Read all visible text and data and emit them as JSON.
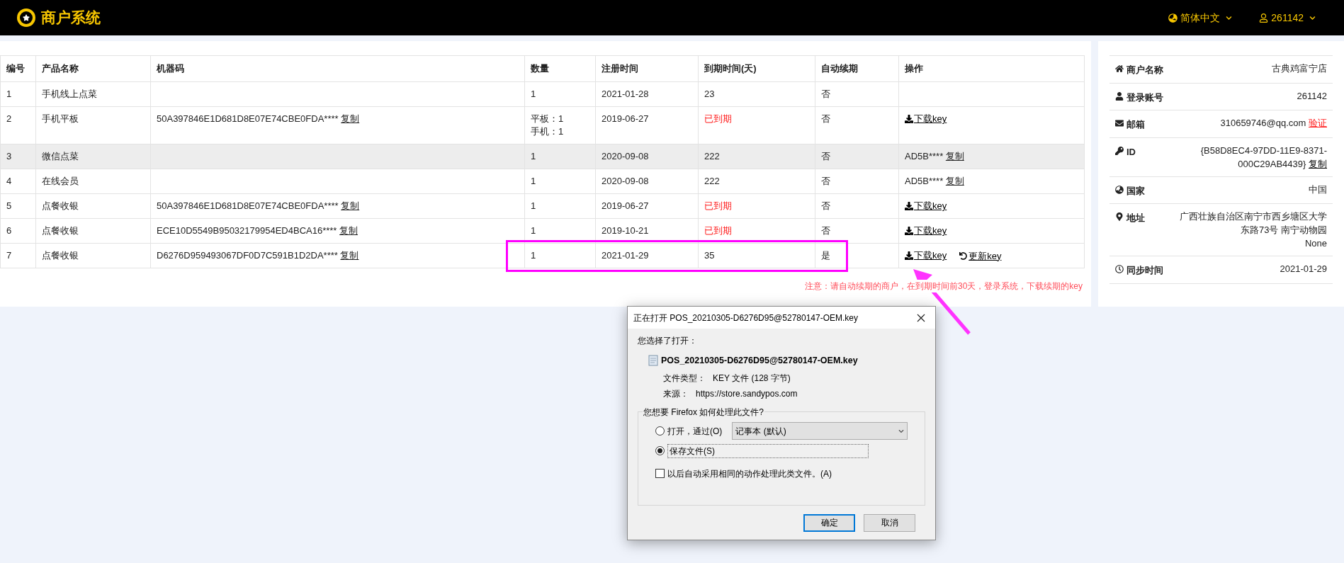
{
  "header": {
    "brand": "商户系统",
    "language": "简体中文",
    "user": "261142"
  },
  "table": {
    "columns": [
      "编号",
      "产品名称",
      "机器码",
      "数量",
      "注册时间",
      "到期时间(天)",
      "自动续期",
      "操作"
    ],
    "rows": [
      {
        "no": "1",
        "product": "手机线上点菜",
        "quantity": [
          "1"
        ],
        "registered": "2021-01-28",
        "expiry": {
          "text": "23",
          "expired": false
        },
        "auto_renew": "否",
        "highlighted": false
      },
      {
        "no": "2",
        "product": "手机平板",
        "machine_code": {
          "code": "50A397846E1D681D8E07E74CBE0FDA****",
          "copy": "复制"
        },
        "quantity": [
          "平板：1",
          "手机：1"
        ],
        "registered": "2019-06-27",
        "expiry": {
          "text": "已到期",
          "expired": true
        },
        "auto_renew": "否",
        "actions": [
          {
            "kind": "download",
            "label": "下载key"
          }
        ],
        "highlighted": false
      },
      {
        "no": "3",
        "product": "微信点菜",
        "quantity": [
          "1"
        ],
        "registered": "2020-09-08",
        "expiry": {
          "text": "222",
          "expired": false
        },
        "auto_renew": "否",
        "actions": [
          {
            "kind": "code",
            "code": "AD5B****",
            "label": "复制"
          }
        ],
        "highlighted": true
      },
      {
        "no": "4",
        "product": "在线会员",
        "quantity": [
          "1"
        ],
        "registered": "2020-09-08",
        "expiry": {
          "text": "222",
          "expired": false
        },
        "auto_renew": "否",
        "actions": [
          {
            "kind": "code",
            "code": "AD5B****",
            "label": "复制"
          }
        ],
        "highlighted": false
      },
      {
        "no": "5",
        "product": "点餐收银",
        "machine_code": {
          "code": "50A397846E1D681D8E07E74CBE0FDA****",
          "copy": "复制"
        },
        "quantity": [
          "1"
        ],
        "registered": "2019-06-27",
        "expiry": {
          "text": "已到期",
          "expired": true
        },
        "auto_renew": "否",
        "actions": [
          {
            "kind": "download",
            "label": "下载key"
          }
        ],
        "highlighted": false
      },
      {
        "no": "6",
        "product": "点餐收银",
        "machine_code": {
          "code": "ECE10D5549B95032179954ED4BCA16****",
          "copy": "复制"
        },
        "quantity": [
          "1"
        ],
        "registered": "2019-10-21",
        "expiry": {
          "text": "已到期",
          "expired": true
        },
        "auto_renew": "否",
        "actions": [
          {
            "kind": "download",
            "label": "下载key"
          }
        ],
        "highlighted": false
      },
      {
        "no": "7",
        "product": "点餐收银",
        "machine_code": {
          "code": "D6276D959493067DF0D7C591B1D2DA****",
          "copy": "复制"
        },
        "quantity": [
          "1"
        ],
        "registered": "2021-01-29",
        "expiry": {
          "text": "35",
          "expired": false
        },
        "auto_renew": "是",
        "actions": [
          {
            "kind": "download",
            "label": "下载key"
          },
          {
            "kind": "renew",
            "label": "更新key"
          }
        ],
        "highlighted": false
      }
    ]
  },
  "notice": "注意：请自动续期的商户，在到期时间前30天，登录系统，下载续期的key",
  "merchant_info": [
    {
      "kind": "home",
      "label": "商户名称",
      "value": [
        "古典鸡富宁店"
      ]
    },
    {
      "kind": "user",
      "label": "登录账号",
      "value": [
        "261142"
      ]
    },
    {
      "kind": "mail",
      "label": "邮箱",
      "value": [
        "310659746@qq.com"
      ],
      "link": {
        "label": "验证",
        "kind": "warning"
      }
    },
    {
      "kind": "key",
      "label": "ID",
      "value": [
        "{B58D8EC4-97DD-11E9-8371-000C29AB4439}"
      ],
      "link": {
        "label": "复制",
        "kind": "plain"
      }
    },
    {
      "kind": "globe",
      "label": "国家",
      "value": [
        "中国"
      ]
    },
    {
      "kind": "pin",
      "label": "地址",
      "value": [
        "广西壮族自治区南宁市西乡塘区大学东路73号 南宁动物园",
        "None"
      ]
    },
    {
      "kind": "clock",
      "label": "同步时间",
      "value": [
        "2021-01-29"
      ]
    }
  ],
  "dialog": {
    "title": "正在打开 POS_20210305-D6276D95@52780147-OEM.key",
    "intro": "您选择了打开：",
    "file_name": "POS_20210305-D6276D95@52780147-OEM.key",
    "details": [
      {
        "label": "文件类型：",
        "value": "KEY 文件 (128 字节)"
      },
      {
        "label": "来源：",
        "value": "https://store.sandypos.com"
      }
    ],
    "group_title": "您想要 Firefox 如何处理此文件?",
    "options": [
      {
        "kind": "radio",
        "label": "打开，通过(O)",
        "selected": false,
        "app": "记事本 (默认)"
      },
      {
        "kind": "radio",
        "label": "保存文件(S)",
        "selected": true
      },
      {
        "kind": "checkbox",
        "label": "以后自动采用相同的动作处理此类文件。(A)",
        "checked": false
      }
    ],
    "buttons": [
      {
        "label": "确定",
        "default": true
      },
      {
        "label": "取消",
        "default": false
      }
    ]
  }
}
